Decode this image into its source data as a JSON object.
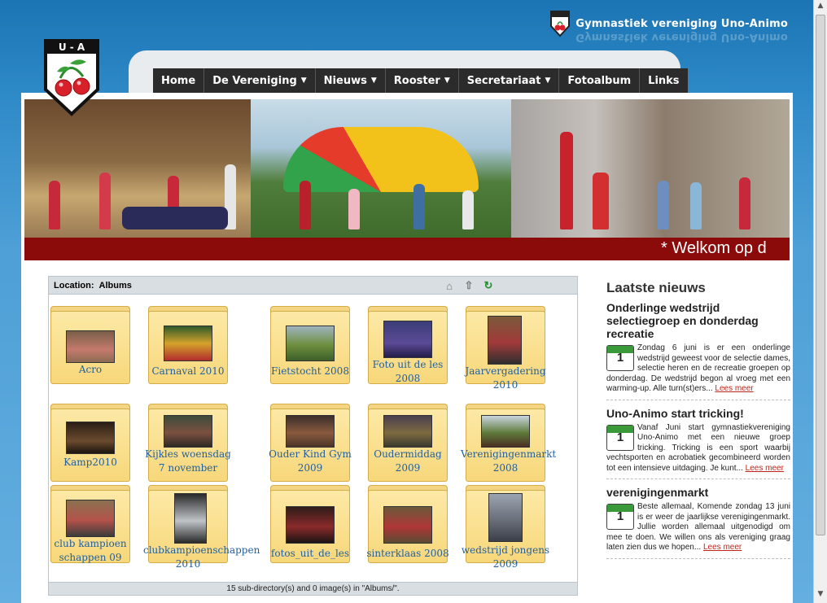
{
  "brand": {
    "title": "Gymnastiek vereniging Uno-Animo",
    "logo_text": "U - A"
  },
  "nav": {
    "items": [
      {
        "label": "Home",
        "has_dropdown": false
      },
      {
        "label": "De Vereniging",
        "has_dropdown": true
      },
      {
        "label": "Nieuws",
        "has_dropdown": true
      },
      {
        "label": "Rooster",
        "has_dropdown": true
      },
      {
        "label": "Secretariaat",
        "has_dropdown": true
      },
      {
        "label": "Fotoalbum",
        "has_dropdown": false
      },
      {
        "label": "Links",
        "has_dropdown": false
      }
    ],
    "caret": "▼"
  },
  "ticker": {
    "text": "* Welkom op d"
  },
  "gallery": {
    "location_label": "Location:",
    "location_value": "Albums",
    "icons": [
      "home-icon",
      "up-folder-icon",
      "refresh-icon"
    ],
    "folders": [
      {
        "label": "Acro"
      },
      {
        "label": "Carnaval 2010"
      },
      {
        "label": "Fietstocht 2008"
      },
      {
        "label": "Foto uit de les 2008"
      },
      {
        "label": "Jaarvergadering 2010"
      },
      {
        "label": "Kamp2010"
      },
      {
        "label": "Kijkles woensdag 7 november"
      },
      {
        "label": "Ouder Kind Gym 2009"
      },
      {
        "label": "Oudermiddag 2009"
      },
      {
        "label": "Verenigingenmarkt 2008"
      },
      {
        "label": "club kampioen schappen 09"
      },
      {
        "label": "clubkampioenschappen 2010"
      },
      {
        "label": "fotos_uit_de_les"
      },
      {
        "label": "sinterklaas 2008"
      },
      {
        "label": "wedstrijd jongens 2009"
      }
    ],
    "status": "15 sub-directory(s) and 0 image(s) in \"Albums/\"."
  },
  "news": {
    "heading": "Laatste nieuws",
    "calendar_day": "1",
    "read_more": "Lees meer",
    "items": [
      {
        "title": "Onderlinge wedstrijd selectiegroep en donderdag recreatie",
        "body": "Zondag 6 juni is er een onderlinge wedstrijd geweest voor de selectie dames, selectie heren en de recreatie groepen op donderdag. De wedstrijd begon al vroeg met een warming-up. Alle turn(st)ers..."
      },
      {
        "title": "Uno-Animo start tricking!",
        "body": "Vanaf Juni start gymnastiekvereniging Uno-Animo met een nieuwe groep tricking. Tricking is een sport waarbij vechtsporten en acrobatiek gecombineerd worden tot een intensieve uitdaging. Je kunt..."
      },
      {
        "title": "verenigingenmarkt",
        "body": "Beste allemaal, Komende zondag 13 juni is er weer de jaarlijkse verenigingenmarkt. Jullie worden allemaal uitgenodigd om mee te doen. We willen ons als vereniging graag laten zien dus we hopen..."
      }
    ]
  }
}
